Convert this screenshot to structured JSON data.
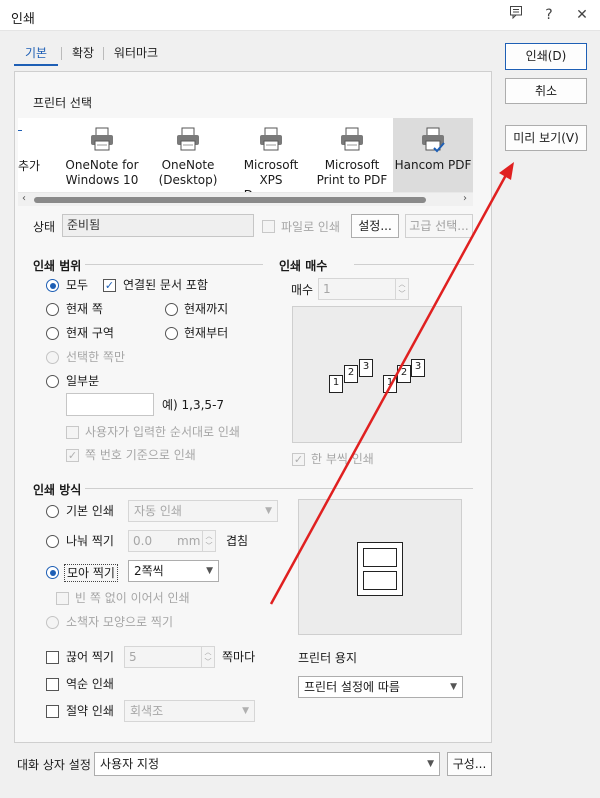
{
  "window": {
    "title": "인쇄"
  },
  "tabs": [
    {
      "label": "기본"
    },
    {
      "label": "확장"
    },
    {
      "label": "워터마크"
    }
  ],
  "actions": {
    "print_label": "인쇄(D)",
    "cancel_label": "취소",
    "preview_label": "미리 보기(V)"
  },
  "printer_select": {
    "title": "프린터 선택",
    "printers": [
      {
        "label": "추가"
      },
      {
        "label": "OneNote for Windows 10"
      },
      {
        "label": "OneNote (Desktop)"
      },
      {
        "label": "Microsoft XPS Docum…"
      },
      {
        "label": "Microsoft Print to PDF"
      },
      {
        "label": "Hancom PDF"
      }
    ],
    "status_label": "상태",
    "status_value": "준비됨",
    "to_file_label": "파일로 인쇄",
    "settings_label": "설정...",
    "advanced_label": "고급 선택..."
  },
  "print_range": {
    "title": "인쇄 범위",
    "all_label": "모두",
    "linked_docs_label": "연결된 문서 포함",
    "current_page_label": "현재 쪽",
    "up_to_current_label": "현재까지",
    "current_area_label": "현재 구역",
    "from_current_label": "현재부터",
    "selected_pages_label": "선택한 쪽만",
    "partial_label": "일부분",
    "partial_example": "예) 1,3,5-7",
    "user_order_label": "사용자가 입력한 순서대로 인쇄",
    "page_number_basis_label": "쪽 번호 기준으로 인쇄"
  },
  "copies": {
    "title": "인쇄 매수",
    "count_label": "매수",
    "count_value": "1",
    "collate_label": "한 부씩 인쇄",
    "preview_pages": [
      "1",
      "2",
      "3",
      "1",
      "2",
      "3"
    ]
  },
  "print_method": {
    "title": "인쇄 방식",
    "basic_label": "기본 인쇄",
    "basic_value": "자동 인쇄",
    "split_label": "나눠 찍기",
    "split_value": "0.0",
    "split_unit": "mm",
    "overlap_label": "겹침",
    "nup_label": "모아 찍기",
    "nup_value": "2쪽씩",
    "continuous_label": "빈 쪽 없이 이어서 인쇄",
    "booklet_label": "소책자 모양으로 찍기",
    "cut_label": "끊어 찍기",
    "cut_value": "5",
    "cut_suffix": "쪽마다",
    "reverse_label": "역순 인쇄",
    "economy_label": "절약 인쇄",
    "economy_value": "회색조"
  },
  "paper": {
    "title": "프린터 용지",
    "value": "프린터 설정에 따름"
  },
  "dialog_settings": {
    "label": "대화 상자 설정",
    "value": "사용자 지정",
    "configure_label": "구성..."
  },
  "colors": {
    "accent": "#1e5fb5",
    "annotation_arrow": "#e02020"
  }
}
